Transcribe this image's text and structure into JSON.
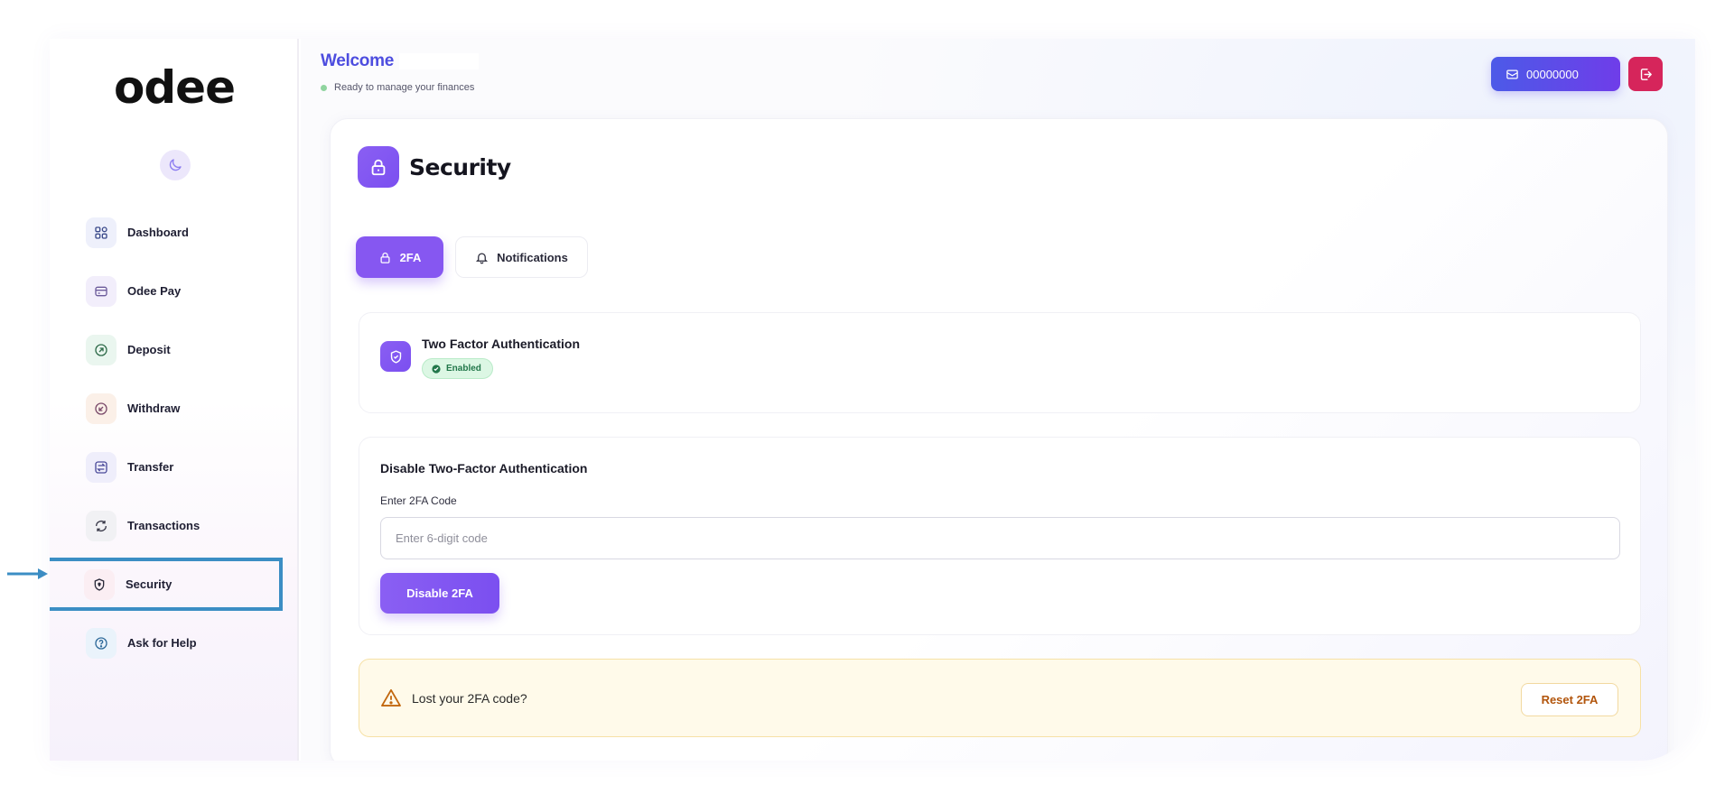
{
  "brand": {
    "logo_text": "odee"
  },
  "sidebar": {
    "items": [
      {
        "label": "Dashboard",
        "icon": "grid-icon",
        "color": "#eef0fb"
      },
      {
        "label": "Odee Pay",
        "icon": "wallet-icon",
        "color": "#f2eefb"
      },
      {
        "label": "Deposit",
        "icon": "deposit-icon",
        "color": "#eaf6ef"
      },
      {
        "label": "Withdraw",
        "icon": "withdraw-icon",
        "color": "#fbf0e8"
      },
      {
        "label": "Transfer",
        "icon": "transfer-icon",
        "color": "#efeefb"
      },
      {
        "label": "Transactions",
        "icon": "refresh-icon",
        "color": "#f1f1f4"
      },
      {
        "label": "Security",
        "icon": "shield-icon",
        "color": "#fbeef3",
        "active": true
      },
      {
        "label": "Ask for Help",
        "icon": "help-icon",
        "color": "#eaf3fb"
      }
    ]
  },
  "header": {
    "welcome": "Welcome",
    "status": "Ready to manage your finances",
    "wallet_number": "00000000"
  },
  "security": {
    "title": "Security",
    "tabs": [
      {
        "label": "2FA",
        "active": true
      },
      {
        "label": "Notifications",
        "active": false
      }
    ],
    "twofa_title": "Two Factor Authentication",
    "twofa_status": "Enabled",
    "disable_title": "Disable Two-Factor Authentication",
    "code_label": "Enter 2FA Code",
    "code_placeholder": "Enter 6-digit code",
    "disable_button": "Disable 2FA",
    "lost_text": "Lost your 2FA code?",
    "reset_button": "Reset 2FA"
  },
  "colors": {
    "accent": "#8657f1",
    "wallet_gradient_start": "#4c5ae8",
    "logout": "#d6255b",
    "enabled_green": "#22774a",
    "highlight_box": "#3b8ec4"
  }
}
